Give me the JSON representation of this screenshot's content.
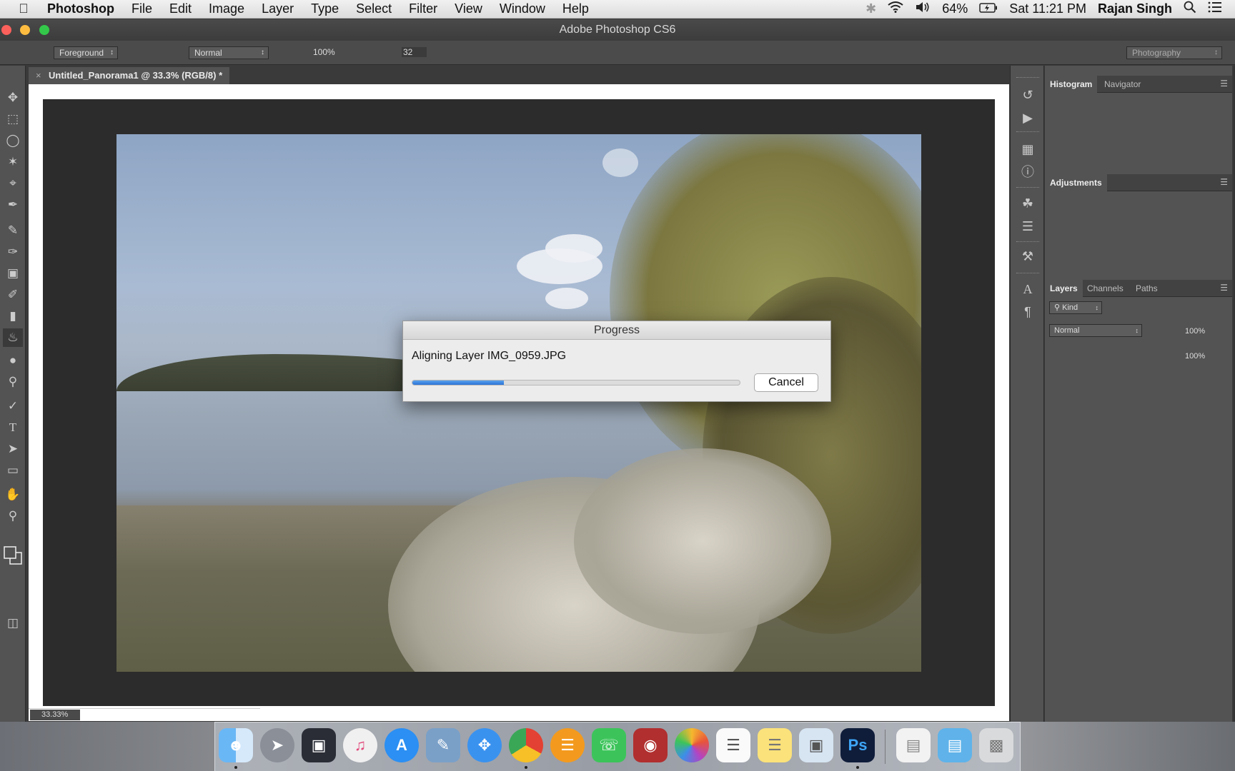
{
  "menubar": {
    "app_name": "Photoshop",
    "items": [
      "File",
      "Edit",
      "Image",
      "Layer",
      "Type",
      "Select",
      "Filter",
      "View",
      "Window",
      "Help"
    ],
    "battery": "64%",
    "clock": "Sat 11:21 PM",
    "user": "Rajan Singh"
  },
  "window": {
    "title": "Adobe Photoshop CS6"
  },
  "options_bar": {
    "fill_source": "Foreground",
    "mode": "Normal",
    "opacity": "100%",
    "tolerance": "32",
    "workspace": "Photography"
  },
  "document": {
    "tab_title": "Untitled_Panorama1 @ 33.3% (RGB/8) *",
    "zoom_status": "33.33%"
  },
  "dialog": {
    "title": "Progress",
    "message": "Aligning Layer IMG_0959.JPG",
    "progress": 0.28,
    "cancel_label": "Cancel"
  },
  "panels": {
    "histogram_tab": "Histogram",
    "navigator_tab": "Navigator",
    "adjustments_tab": "Adjustments",
    "layers_tab": "Layers",
    "channels_tab": "Channels",
    "paths_tab": "Paths",
    "kind_filter": "Kind",
    "blend_mode": "Normal",
    "opacity": "100%",
    "fill": "100%"
  },
  "colors": {
    "accent_progress": "#2b73d6",
    "panel_bg": "#535353",
    "menubar_bg": "#e6e6e6"
  },
  "icons": {
    "toolbar": [
      "move-icon",
      "marquee-icon",
      "lasso-icon",
      "magic-wand-icon",
      "crop-icon",
      "eyedropper-icon",
      "healing-brush-icon",
      "brush-icon",
      "clone-stamp-icon",
      "history-brush-icon",
      "eraser-icon",
      "paint-bucket-icon",
      "blur-icon",
      "dodge-icon",
      "pen-icon",
      "type-icon",
      "path-selection-icon",
      "rectangle-icon",
      "hand-icon",
      "zoom-icon"
    ],
    "dock": [
      "finder",
      "launchpad",
      "photo-booth-like",
      "itunes",
      "app-store",
      "preview",
      "safari",
      "chrome",
      "ibooks",
      "facetime",
      "photo-booth",
      "photos",
      "reminders",
      "notes",
      "preview-2",
      "photoshop",
      "document",
      "folder",
      "trash"
    ]
  }
}
